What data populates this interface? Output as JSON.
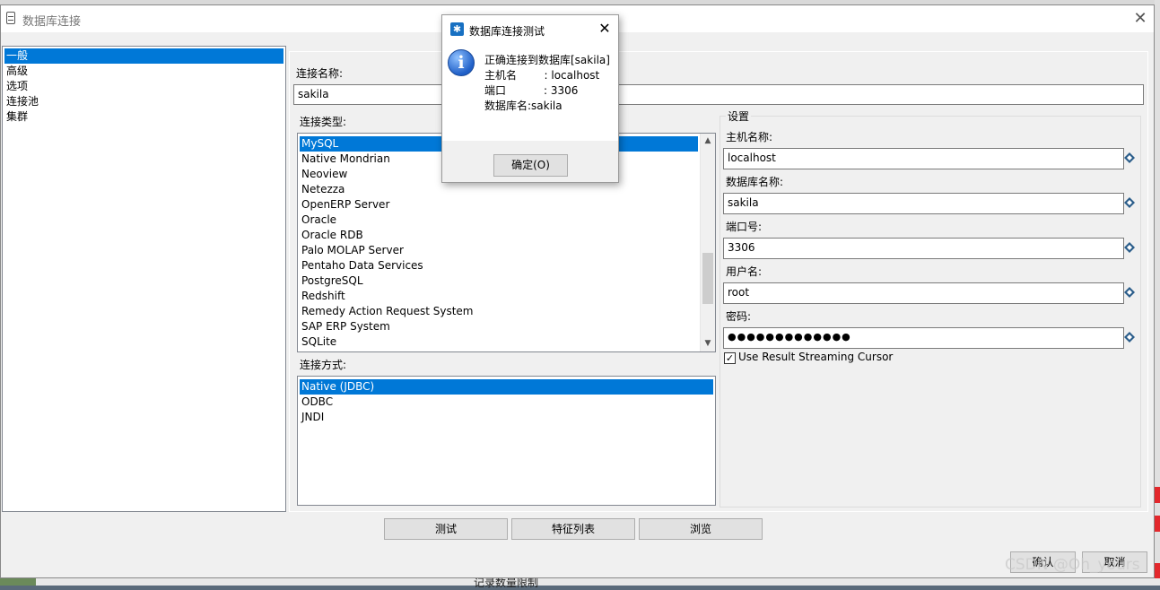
{
  "window": {
    "title": "数据库连接",
    "close_glyph": "✕"
  },
  "nav": {
    "items": [
      "一般",
      "高级",
      "选项",
      "连接池",
      "集群"
    ],
    "selected_index": 0
  },
  "connection_name": {
    "label": "连接名称:",
    "value": "sakila"
  },
  "connection_type": {
    "label": "连接类型:",
    "items": [
      "MySQL",
      "Native Mondrian",
      "Neoview",
      "Netezza",
      "OpenERP Server",
      "Oracle",
      "Oracle RDB",
      "Palo MOLAP Server",
      "Pentaho Data Services",
      "PostgreSQL",
      "Redshift",
      "Remedy Action Request System",
      "SAP ERP System",
      "SQLite"
    ],
    "selected_index": 0
  },
  "access_method": {
    "label": "连接方式:",
    "items": [
      "Native (JDBC)",
      "ODBC",
      "JNDI"
    ],
    "selected_index": 0
  },
  "settings": {
    "title": "设置",
    "host_label": "主机名称:",
    "host_value": "localhost",
    "db_label": "数据库名称:",
    "db_value": "sakila",
    "port_label": "端口号:",
    "port_value": "3306",
    "user_label": "用户名:",
    "user_value": "root",
    "password_label": "密码:",
    "password_value": "●●●●●●●●●●●●●",
    "streaming_label": "Use Result Streaming Cursor",
    "streaming_checked": true,
    "variable_icon": "variable-diamond-icon"
  },
  "buttons": {
    "test": "测试",
    "features": "特征列表",
    "explore": "浏览",
    "ok": "确认",
    "cancel": "取消"
  },
  "message_box": {
    "title": "数据库连接测试",
    "icon": "info-icon",
    "lines": [
      "正确连接到数据库[sakila]",
      "主机名        : localhost",
      "端口           : 3306",
      "数据库名:sakila"
    ],
    "ok": "确定(O)"
  },
  "background": {
    "bottom_label": "记录数量限制"
  },
  "watermark": "CSDN @Oh_yours",
  "colors": {
    "selection": "#0078d7",
    "info_icon": "#1f5fc7"
  }
}
